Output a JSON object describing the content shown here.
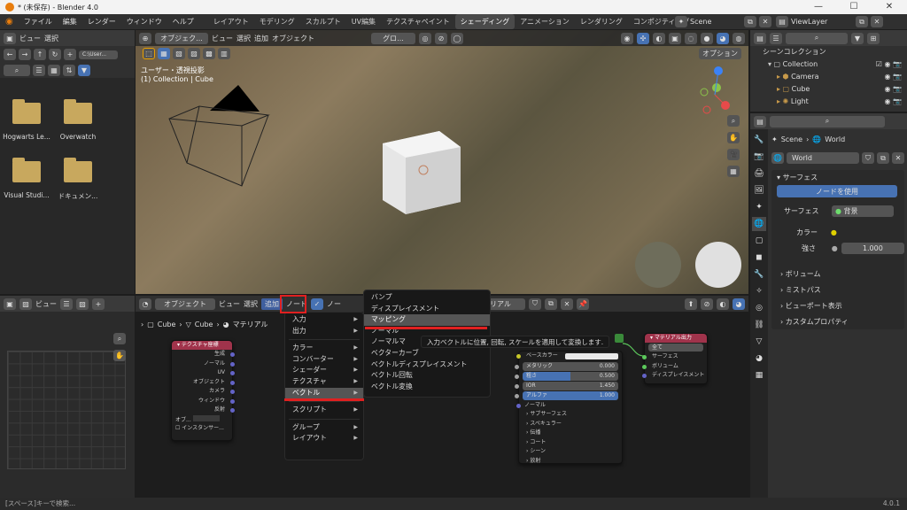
{
  "window": {
    "title": "* (未保存) - Blender 4.0",
    "min": "—",
    "max": "☐",
    "close": "✕"
  },
  "menus": [
    "ファイル",
    "編集",
    "レンダー",
    "ウィンドウ",
    "ヘルプ"
  ],
  "workspaces": [
    "レイアウト",
    "モデリング",
    "スカルプト",
    "UV編集",
    "テクスチャペイント",
    "シェーディング",
    "アニメーション",
    "レンダリング",
    "コンポジティング"
  ],
  "active_workspace_index": 5,
  "scene": {
    "label": "Scene",
    "viewlayer": "ViewLayer"
  },
  "filebrowser": {
    "view": "ビュー",
    "select": "選択",
    "path": "C:\\User...",
    "items": [
      "Hogwarts Le...",
      "Overwatch",
      "Visual Studi...",
      "ドキュメン..."
    ]
  },
  "viewport": {
    "mode": "オブジェク...",
    "menus": [
      "ビュー",
      "選択",
      "追加",
      "オブジェクト"
    ],
    "transform": "グロ...",
    "options": "オプション",
    "info1": "ユーザー・透視投影",
    "info2": "(1) Collection | Cube"
  },
  "outliner": {
    "title": "シーンコレクション",
    "collection": "Collection",
    "items": [
      "Camera",
      "Cube",
      "Light"
    ]
  },
  "properties": {
    "breadcrumb_scene": "Scene",
    "breadcrumb_world": "World",
    "world_name": "World",
    "surface": "サーフェス",
    "use_nodes": "ノードを使用",
    "surface_label": "サーフェス",
    "surface_value": "背景",
    "color_label": "カラー",
    "strength_label": "強さ",
    "strength_value": "1.000",
    "sections": [
      "ボリューム",
      "ミストパス",
      "ビューポート表示",
      "カスタムプロパティ"
    ]
  },
  "node_editor": {
    "mode": "オブジェクト",
    "menus": [
      "ビュー",
      "選択",
      "追加",
      "ノード"
    ],
    "check_label": "ノー",
    "material": "マテリアル",
    "breadcrumb": [
      "Cube",
      "Cube",
      "マテリアル"
    ]
  },
  "image_editor": {
    "view": "ビュー"
  },
  "add_menu": {
    "items": [
      "入力",
      "出力",
      "カラー",
      "コンバーター",
      "シェーダー",
      "テクスチャ",
      "ベクトル",
      "スクリプト",
      "グループ",
      "レイアウト"
    ],
    "active_index": 6
  },
  "vector_menu": {
    "items": [
      "バンプ",
      "ディスプレイスメント",
      "マッピング",
      "ノーマル",
      "ノーマルマ",
      "ベクターカーブ",
      "ベクトルディスプレイスメント",
      "ベクトル回転",
      "ベクトル変換"
    ],
    "highlight_index": 2
  },
  "tooltip": "入力ベクトルに位置, 回転, スケールを適用して変換します.",
  "texcoord_node": {
    "title": "テクスチャ座標",
    "outputs": [
      "生成",
      "ノーマル",
      "UV",
      "オブジェクト",
      "カメラ",
      "ウィンドウ",
      "反射"
    ],
    "obj_label": "オブ...",
    "instancer": "インスタンサー..."
  },
  "bsdf_node": {
    "base_color": "ベースカラー",
    "metallic": "メタリック",
    "metallic_v": "0.000",
    "roughness": "粗さ",
    "roughness_v": "0.500",
    "ior": "IOR",
    "ior_v": "1.450",
    "alpha": "アルファ",
    "alpha_v": "1.000",
    "normal": "ノーマル",
    "subs": [
      "サブサーフェス",
      "スペキュラー",
      "伝播",
      "コート",
      "シーン",
      "放射"
    ]
  },
  "output_node": {
    "title": "マテリアル出力",
    "target": "全て",
    "sockets": [
      "サーフェス",
      "ボリューム",
      "ディスプレイスメント"
    ]
  },
  "status": {
    "left": "[スペース]キーで検索...",
    "right": "4.0.1"
  }
}
